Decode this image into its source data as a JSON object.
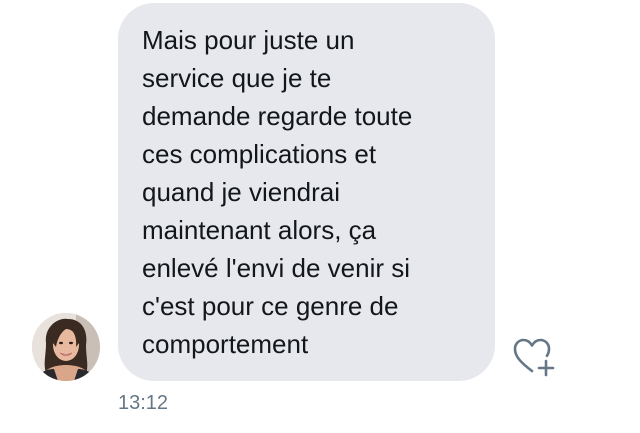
{
  "message": {
    "lines": [
      "Mais pour juste un",
      "service que je te",
      "demande regarde toute",
      "ces complications et",
      "quand je viendrai",
      "maintenant alors, ça",
      "enlevé l'envi de venir si",
      "c'est pour ce genre de",
      "comportement"
    ],
    "timestamp": "13:12"
  },
  "icons": {
    "avatar": "user-avatar-photo",
    "like": "heart-plus-icon"
  },
  "colors": {
    "bubble_background": "#e6e8ee",
    "message_text": "#14171a",
    "timestamp_text": "#657786",
    "icon_stroke": "#657786"
  }
}
